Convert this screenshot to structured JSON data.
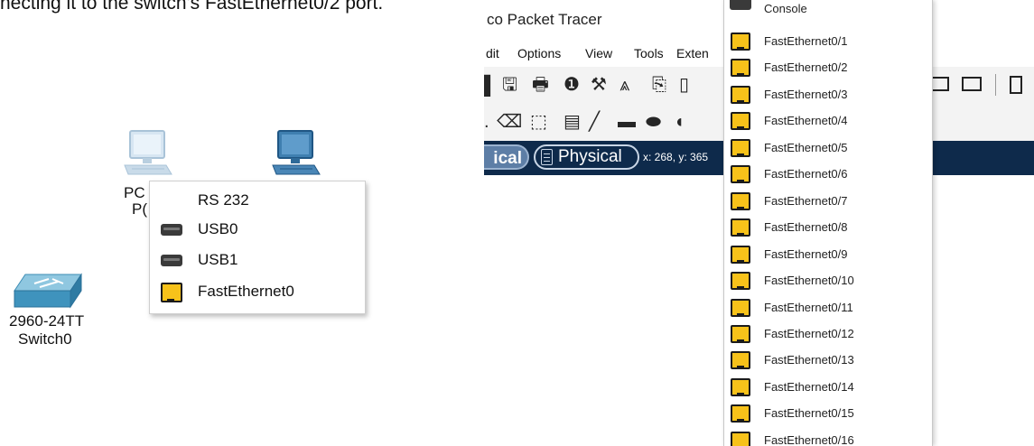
{
  "instruction_text": "necting it to the switch's FastEthernet0/2 port.",
  "topology": {
    "pc0_label_line1": "PC",
    "pc0_label_line2": "P(",
    "switch_model": "2960-24TT",
    "switch_name": "Switch0"
  },
  "pc_port_menu": {
    "items": [
      {
        "label": "RS 232",
        "icon": "none"
      },
      {
        "label": "USB0",
        "icon": "usb-icon"
      },
      {
        "label": "USB1",
        "icon": "usb-icon"
      },
      {
        "label": "FastEthernet0",
        "icon": "ethernet-port-icon"
      }
    ]
  },
  "packet_tracer": {
    "title": "co Packet Tracer",
    "menu": [
      "dit",
      "Options",
      "View",
      "Tools",
      "Exten"
    ],
    "tab_logical": "ical",
    "tab_physical": "Physical",
    "coordinates": "x: 268, y: 365"
  },
  "switch_port_list": {
    "console_label": "Console",
    "ports": [
      "FastEthernet0/1",
      "FastEthernet0/2",
      "FastEthernet0/3",
      "FastEthernet0/4",
      "FastEthernet0/5",
      "FastEthernet0/6",
      "FastEthernet0/7",
      "FastEthernet0/8",
      "FastEthernet0/9",
      "FastEthernet0/10",
      "FastEthernet0/11",
      "FastEthernet0/12",
      "FastEthernet0/13",
      "FastEthernet0/14",
      "FastEthernet0/15",
      "FastEthernet0/16"
    ]
  },
  "colors": {
    "tab_bar": "#0e2a4b",
    "ethernet_port": "#f7c21a",
    "device_blue": "#3f7fb0"
  }
}
